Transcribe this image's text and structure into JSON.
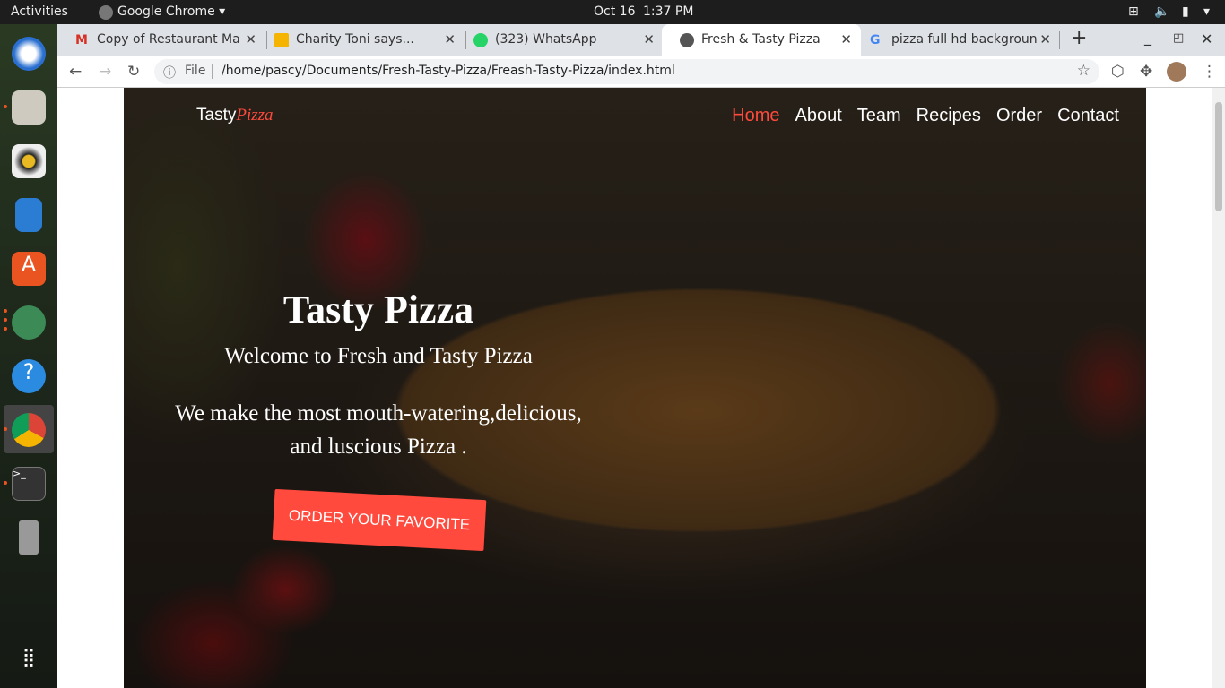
{
  "system": {
    "activities": "Activities",
    "app": "Google Chrome",
    "date": "Oct 16",
    "time": "1:37 PM"
  },
  "tabs": [
    {
      "title": "Copy of Restaurant Ma",
      "icon": "gmail-icon"
    },
    {
      "title": "Charity Toni says...",
      "icon": "slides-icon"
    },
    {
      "title": "(323) WhatsApp",
      "icon": "whatsapp-icon"
    },
    {
      "title": "Fresh & Tasty Pizza",
      "icon": "globe-icon",
      "active": true
    },
    {
      "title": "pizza full hd backgroun",
      "icon": "google-icon"
    }
  ],
  "address": {
    "scheme": "File",
    "url": "/home/pascy/Documents/Fresh-Tasty-Pizza/Freash-Tasty-Pizza/index.html"
  },
  "site": {
    "logo_a": "Tasty",
    "logo_b": "Pizza",
    "nav": [
      "Home",
      "About",
      "Team",
      "Recipes",
      "Order",
      "Contact"
    ],
    "title": "Tasty Pizza",
    "subtitle": "Welcome to Fresh and Tasty Pizza",
    "line1": "We make the most mouth-watering,delicious,",
    "line2": "and luscious Pizza .",
    "cta": "ORDER YOUR FAVORITE"
  },
  "colors": {
    "accent": "#ff4a3d"
  }
}
